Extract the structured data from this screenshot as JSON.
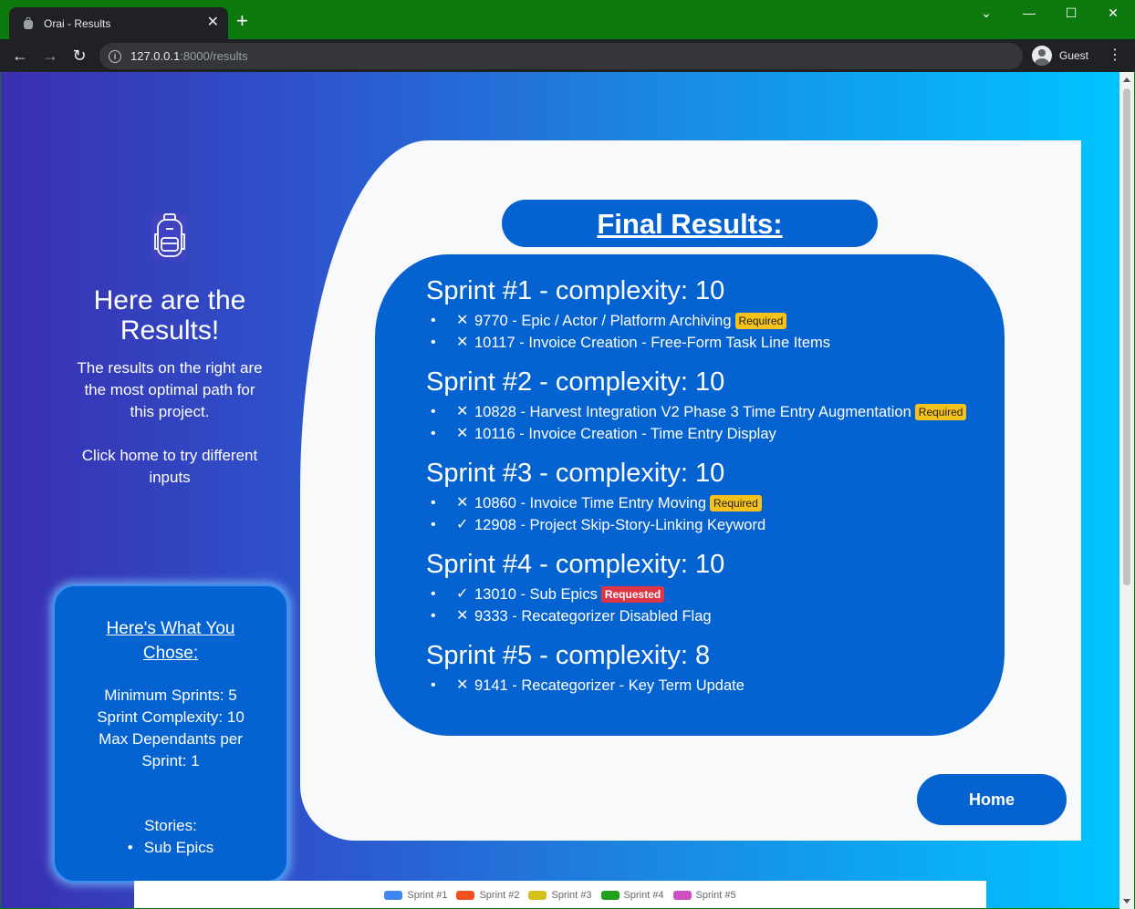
{
  "browser": {
    "tab_title": "Orai - Results",
    "tab_close": "✕",
    "new_tab": "+",
    "url_host": "127.0.0.1",
    "url_path": ":8000/results",
    "profile_label": "Guest",
    "window_controls": {
      "collapse": "⌄",
      "minimize": "—",
      "maximize": "☐",
      "close": "✕"
    }
  },
  "left": {
    "heading": "Here are the Results!",
    "description": "The results on the right are the most optimal path for this project.",
    "hint": "Click home to try different inputs"
  },
  "choices": {
    "title": "Here's What You Chose:",
    "min_sprints": "Minimum Sprints: 5",
    "sprint_complexity": "Sprint Complexity: 10",
    "max_dependants": "Max Dependants per Sprint: 1",
    "stories_label": "Stories:",
    "stories": [
      "Sub Epics"
    ]
  },
  "results": {
    "title": "Final Results:",
    "sprints": [
      {
        "title": "Sprint #1 - complexity: 10",
        "items": [
          {
            "mark": "✕",
            "text": "9770 - Epic / Actor / Platform Archiving",
            "badge": "Required"
          },
          {
            "mark": "✕",
            "text": "10117 - Invoice Creation - Free-Form Task Line Items",
            "badge": ""
          }
        ]
      },
      {
        "title": "Sprint #2 - complexity: 10",
        "items": [
          {
            "mark": "✕",
            "text": "10828 - Harvest Integration V2 Phase 3 Time Entry Augmentation",
            "badge": "Required"
          },
          {
            "mark": "✕",
            "text": "10116 - Invoice Creation - Time Entry Display",
            "badge": ""
          }
        ]
      },
      {
        "title": "Sprint #3 - complexity: 10",
        "items": [
          {
            "mark": "✕",
            "text": "10860 - Invoice Time Entry Moving",
            "badge": "Required"
          },
          {
            "mark": "✓",
            "text": "12908 - Project Skip-Story-Linking Keyword",
            "badge": ""
          }
        ]
      },
      {
        "title": "Sprint #4 - complexity: 10",
        "items": [
          {
            "mark": "✓",
            "text": "13010 - Sub Epics",
            "badge": "Requested"
          },
          {
            "mark": "✕",
            "text": "9333 - Recategorizer Disabled Flag",
            "badge": ""
          }
        ]
      },
      {
        "title": "Sprint #5 - complexity: 8",
        "items": [
          {
            "mark": "✕",
            "text": "9141 - Recategorizer - Key Term Update",
            "badge": ""
          }
        ]
      }
    ]
  },
  "home_button": "Home",
  "legend": [
    {
      "label": "Sprint #1",
      "color": "#4285f4"
    },
    {
      "label": "Sprint #2",
      "color": "#f4511e"
    },
    {
      "label": "Sprint #3",
      "color": "#d4c21a"
    },
    {
      "label": "Sprint #4",
      "color": "#1ea21e"
    },
    {
      "label": "Sprint #5",
      "color": "#d04fc0"
    }
  ]
}
